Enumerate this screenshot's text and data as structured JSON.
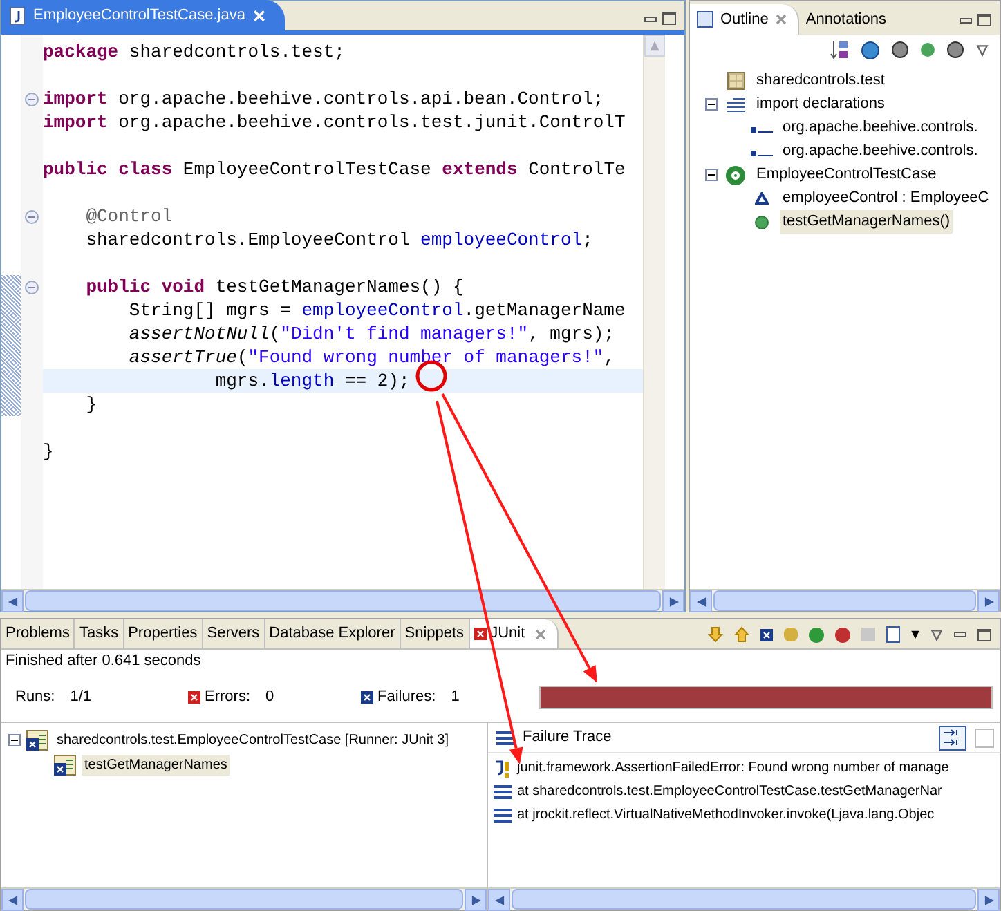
{
  "editor": {
    "tab": {
      "title": "EmployeeControlTestCase.java",
      "selected": true
    },
    "lines": [
      {
        "fold": false,
        "current": false,
        "changed": false,
        "tokens": [
          {
            "kind": "kw",
            "text": "package"
          },
          {
            "kind": "plain",
            "text": " sharedcontrols.test;"
          }
        ]
      },
      {
        "fold": false,
        "current": false,
        "changed": false
      },
      {
        "fold": true,
        "current": false,
        "changed": false,
        "tokens": [
          {
            "kind": "kw",
            "text": "import"
          },
          {
            "kind": "plain",
            "text": " org.apache.beehive.controls.api.bean.Control;"
          }
        ]
      },
      {
        "fold": false,
        "current": false,
        "changed": false,
        "tokens": [
          {
            "kind": "kw",
            "text": "import"
          },
          {
            "kind": "plain",
            "text": " org.apache.beehive.controls.test.junit.ControlT"
          }
        ]
      },
      {
        "fold": false,
        "current": false,
        "changed": false
      },
      {
        "fold": false,
        "current": false,
        "changed": false,
        "tokens": [
          {
            "kind": "kw",
            "text": "public class"
          },
          {
            "kind": "plain",
            "text": " EmployeeControlTestCase "
          },
          {
            "kind": "kw",
            "text": "extends"
          },
          {
            "kind": "plain",
            "text": " ControlTe"
          }
        ]
      },
      {
        "fold": false,
        "current": false,
        "changed": false
      },
      {
        "fold": true,
        "current": false,
        "changed": false,
        "tokens": [
          {
            "kind": "annotation",
            "text": "    @Control"
          }
        ]
      },
      {
        "fold": false,
        "current": false,
        "changed": false,
        "tokens": [
          {
            "kind": "plain",
            "text": "    sharedcontrols.EmployeeControl "
          },
          {
            "kind": "field",
            "text": "employeeControl"
          },
          {
            "kind": "plain",
            "text": ";"
          }
        ]
      },
      {
        "fold": false,
        "current": false,
        "changed": false
      },
      {
        "fold": true,
        "current": false,
        "changed": true,
        "tokens": [
          {
            "kind": "kw",
            "text": "    public void"
          },
          {
            "kind": "plain",
            "text": " testGetManagerNames() {"
          }
        ]
      },
      {
        "fold": false,
        "current": false,
        "changed": true,
        "tokens": [
          {
            "kind": "plain",
            "text": "        String[] mgrs = "
          },
          {
            "kind": "field",
            "text": "employeeControl"
          },
          {
            "kind": "plain",
            "text": ".getManagerName"
          }
        ]
      },
      {
        "fold": false,
        "current": false,
        "changed": true,
        "tokens": [
          {
            "kind": "static",
            "text": "        assertNotNull"
          },
          {
            "kind": "plain",
            "text": "("
          },
          {
            "kind": "string",
            "text": "\"Didn't find managers!\""
          },
          {
            "kind": "plain",
            "text": ", mgrs);"
          }
        ]
      },
      {
        "fold": false,
        "current": false,
        "changed": true,
        "tokens": [
          {
            "kind": "static",
            "text": "        assertTrue"
          },
          {
            "kind": "plain",
            "text": "("
          },
          {
            "kind": "string",
            "text": "\"Found wrong number of managers!\""
          },
          {
            "kind": "plain",
            "text": ","
          }
        ]
      },
      {
        "fold": false,
        "current": true,
        "changed": true,
        "tokens": [
          {
            "kind": "plain",
            "text": "                mgrs."
          },
          {
            "kind": "field",
            "text": "length"
          },
          {
            "kind": "plain",
            "text": " == 2);"
          }
        ]
      },
      {
        "fold": false,
        "current": false,
        "changed": true,
        "tokens": [
          {
            "kind": "plain",
            "text": "    }"
          }
        ]
      },
      {
        "fold": false,
        "current": false,
        "changed": false
      },
      {
        "fold": false,
        "current": false,
        "changed": false,
        "tokens": [
          {
            "kind": "plain",
            "text": "}"
          }
        ]
      }
    ]
  },
  "outline": {
    "tabs": [
      {
        "label": "Outline",
        "selected": true
      },
      {
        "label": "Annotations",
        "selected": false
      }
    ],
    "tree": [
      {
        "label": "sharedcontrols.test",
        "kind": "package",
        "selected": false
      },
      {
        "label": "import declarations",
        "kind": "imports",
        "selected": false,
        "expanded": true,
        "children": [
          {
            "label": "org.apache.beehive.controls.",
            "kind": "import",
            "selected": false
          },
          {
            "label": "org.apache.beehive.controls.",
            "kind": "import",
            "selected": false
          }
        ]
      },
      {
        "label": "EmployeeControlTestCase",
        "kind": "class",
        "selected": false,
        "expanded": true,
        "children": [
          {
            "label": "employeeControl : EmployeeC",
            "kind": "field",
            "selected": false
          },
          {
            "label": "testGetManagerNames()",
            "kind": "method",
            "selected": true
          }
        ]
      }
    ]
  },
  "bottom": {
    "tabs": [
      {
        "label": "Problems",
        "selected": false
      },
      {
        "label": "Tasks",
        "selected": false
      },
      {
        "label": "Properties",
        "selected": false
      },
      {
        "label": "Servers",
        "selected": false
      },
      {
        "label": "Database Explorer",
        "selected": false
      },
      {
        "label": "Snippets",
        "selected": false
      },
      {
        "label": "JUnit",
        "selected": true
      }
    ],
    "status": "Finished after 0.641 seconds",
    "counters": [
      {
        "kind": "runs",
        "label": "Runs:",
        "value": "1/1"
      },
      {
        "kind": "errors",
        "label": "Errors:",
        "value": "0"
      },
      {
        "kind": "failures",
        "label": "Failures:",
        "value": "1"
      }
    ],
    "progress": {
      "level": 1,
      "failed": true
    },
    "tests": [
      {
        "label": "sharedcontrols.test.EmployeeControlTestCase [Runner: JUnit 3]",
        "selected": false,
        "expanded": true,
        "children": [
          {
            "label": "testGetManagerNames",
            "selected": true
          }
        ]
      }
    ],
    "trace": {
      "title": "Failure Trace",
      "lines": [
        {
          "kind": "error",
          "text": "junit.framework.AssertionFailedError: Found wrong number of manage"
        },
        {
          "kind": "frame",
          "text": "at sharedcontrols.test.EmployeeControlTestCase.testGetManagerNar"
        },
        {
          "kind": "frame",
          "text": "at jrockit.reflect.VirtualNativeMethodInvoker.invoke(Ljava.lang.Objec"
        }
      ]
    }
  }
}
